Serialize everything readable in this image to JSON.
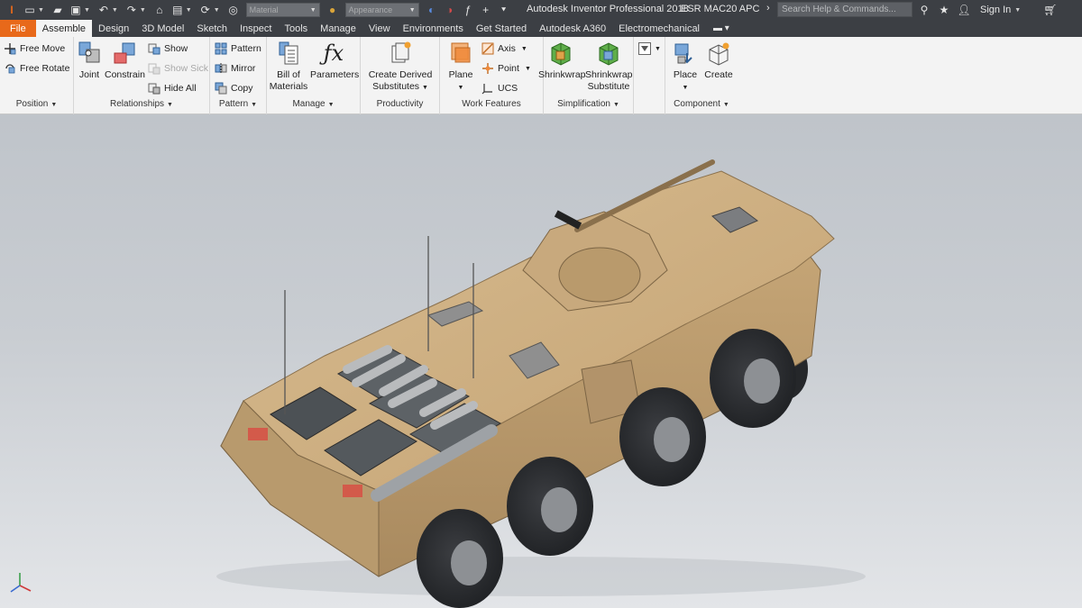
{
  "titlebar": {
    "app_title": "Autodesk Inventor Professional 2018",
    "doc_title": "ESR MAC20 APC",
    "search_placeholder": "Search Help & Commands...",
    "sign_in": "Sign In",
    "material_combo": "Material",
    "appearance_combo": "Appearance"
  },
  "tabs": [
    {
      "label": "File"
    },
    {
      "label": "Assemble"
    },
    {
      "label": "Design"
    },
    {
      "label": "3D Model"
    },
    {
      "label": "Sketch"
    },
    {
      "label": "Inspect"
    },
    {
      "label": "Tools"
    },
    {
      "label": "Manage"
    },
    {
      "label": "View"
    },
    {
      "label": "Environments"
    },
    {
      "label": "Get Started"
    },
    {
      "label": "Autodesk A360"
    },
    {
      "label": "Electromechanical"
    }
  ],
  "ribbon": {
    "position": {
      "title": "Position",
      "free_move": "Free Move",
      "free_rotate": "Free Rotate"
    },
    "relationships": {
      "title": "Relationships",
      "joint": "Joint",
      "constrain": "Constrain",
      "show": "Show",
      "show_sick": "Show Sick",
      "hide_all": "Hide All"
    },
    "pattern": {
      "title": "Pattern",
      "pattern": "Pattern",
      "mirror": "Mirror",
      "copy": "Copy"
    },
    "manage": {
      "title": "Manage",
      "bom_line1": "Bill of",
      "bom_line2": "Materials",
      "parameters": "Parameters"
    },
    "productivity": {
      "title": "Productivity",
      "line1": "Create Derived",
      "line2": "Substitutes"
    },
    "work_features": {
      "title": "Work Features",
      "plane": "Plane",
      "axis": "Axis",
      "point": "Point",
      "ucs": "UCS"
    },
    "simplification": {
      "title": "Simplification",
      "shrinkwrap": "Shrinkwrap",
      "sw_sub_line1": "Shrinkwrap",
      "sw_sub_line2": "Substitute"
    },
    "component": {
      "title": "Component",
      "place": "Place",
      "create": "Create"
    }
  },
  "colors": {
    "titlebar_bg": "#3c3f44",
    "file_tab": "#e8691a",
    "ribbon_bg": "#f3f3f3",
    "vehicle_hull": "#c9ab7f",
    "wheel": "#2b2d30"
  },
  "viewport": {
    "model": "8-wheeled armored personnel carrier"
  }
}
